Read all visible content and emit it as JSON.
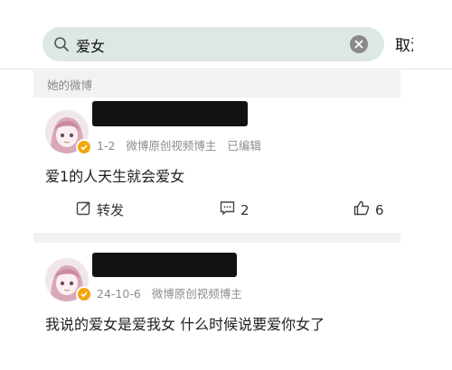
{
  "search": {
    "query": "爱女",
    "cancel_label": "取消"
  },
  "section": {
    "label": "她的微博"
  },
  "posts": [
    {
      "meta": {
        "date": "1-2",
        "tag": "微博原创视频博主",
        "edited": "已编辑"
      },
      "text": "爱1的人天生就会爱女",
      "actions": {
        "repost_label": "转发",
        "comment_count": "2",
        "like_count": "6"
      }
    },
    {
      "meta": {
        "date": "24-10-6",
        "tag": "微博原创视频博主"
      },
      "text": "我说的爱女是爱我女 什么时候说要爱你女了"
    }
  ],
  "colors": {
    "search_bg": "#dde8e6",
    "section_bg": "#f2f2f2",
    "badge": "#f3a70f",
    "meta_text": "#8c8c8c"
  },
  "icons": [
    "search-icon",
    "clear-icon",
    "verified-badge-icon",
    "repost-icon",
    "comment-icon",
    "like-icon"
  ]
}
